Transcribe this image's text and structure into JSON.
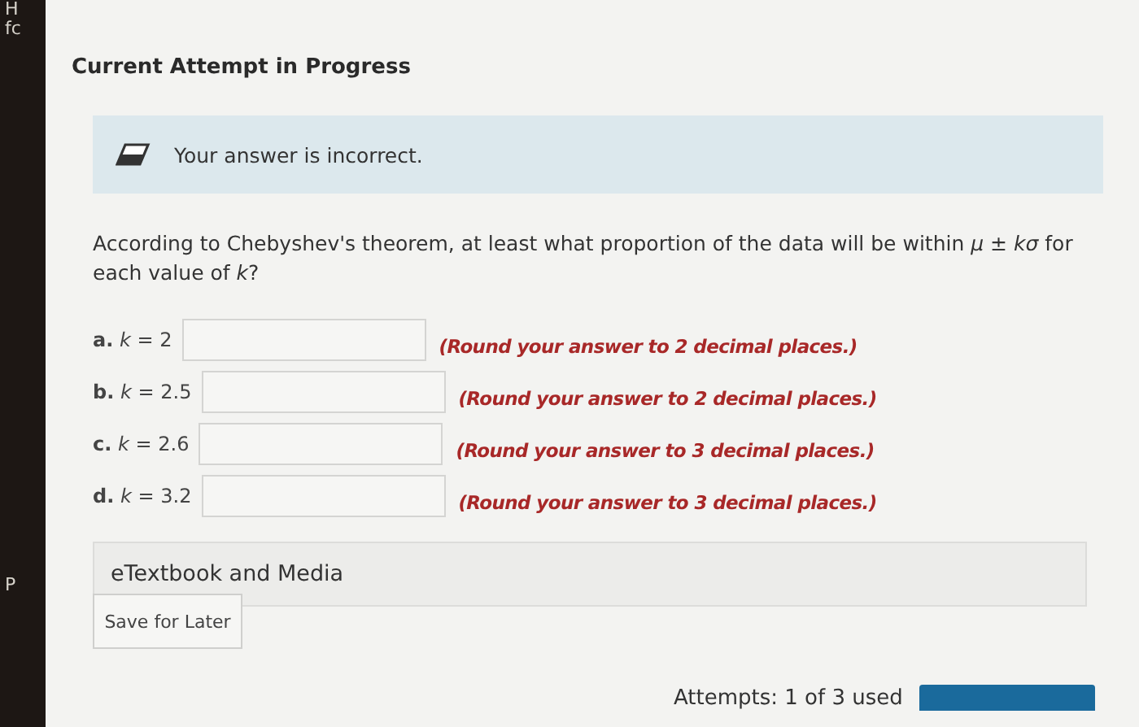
{
  "edge_fragments": [
    "H",
    "fc",
    "P"
  ],
  "title": "Current Attempt in Progress",
  "feedback": {
    "text": "Your answer is incorrect."
  },
  "question": "According to Chebyshev's theorem, at least what proportion of the data will be within *μ* ± *kσ* for each value of *k*?",
  "parts": [
    {
      "label": "**a.** *k* = 2",
      "hint": "(Round your answer to 2 decimal places.)"
    },
    {
      "label": "**b.** *k* = 2.5",
      "hint": "(Round your answer to 2 decimal places.)"
    },
    {
      "label": "**c.** *k* = 2.6",
      "hint": "(Round your answer to 3 decimal places.)"
    },
    {
      "label": "**d.** *k* = 3.2",
      "hint": "(Round your answer to 3 decimal places.)"
    }
  ],
  "media": {
    "label": "eTextbook and Media"
  },
  "save_button": "Save for Later",
  "attempts": "Attempts: 1 of 3 used"
}
